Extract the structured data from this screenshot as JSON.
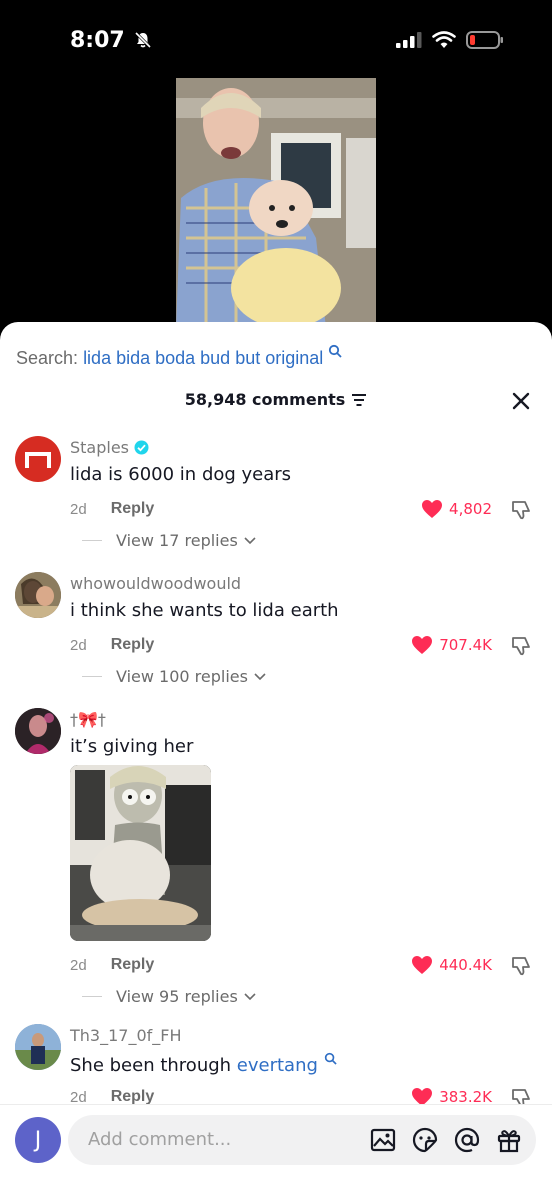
{
  "status_bar": {
    "time": "8:07"
  },
  "search": {
    "label": "Search:",
    "query": "lida bida boda bud but original"
  },
  "header": {
    "comment_count": "58,948 comments"
  },
  "comments": [
    {
      "user": "Staples",
      "verified": true,
      "text": "lida is 6000 in dog years",
      "age": "2d",
      "reply_label": "Reply",
      "likes": "4,802",
      "view_replies": "View 17 replies"
    },
    {
      "user": "whowouldwoodwould",
      "text": "i think she wants to lida earth",
      "age": "2d",
      "reply_label": "Reply",
      "likes": "707.4K",
      "view_replies": "View 100 replies"
    },
    {
      "user": "†🎀†",
      "text": "it’s giving her",
      "age": "2d",
      "reply_label": "Reply",
      "likes": "440.4K",
      "view_replies": "View 95 replies"
    },
    {
      "user": "Th3_17_0f_FH",
      "text": "She been through ",
      "text_link": "evertang",
      "age": "2d",
      "reply_label": "Reply",
      "likes": "383.2K"
    }
  ],
  "bottom": {
    "avatar_letter": "J",
    "placeholder": "Add comment..."
  },
  "colors": {
    "like": "#fe2c55",
    "link": "#2f6ec4",
    "staples_red": "#d62c22",
    "me_avatar": "#5d63c9"
  }
}
